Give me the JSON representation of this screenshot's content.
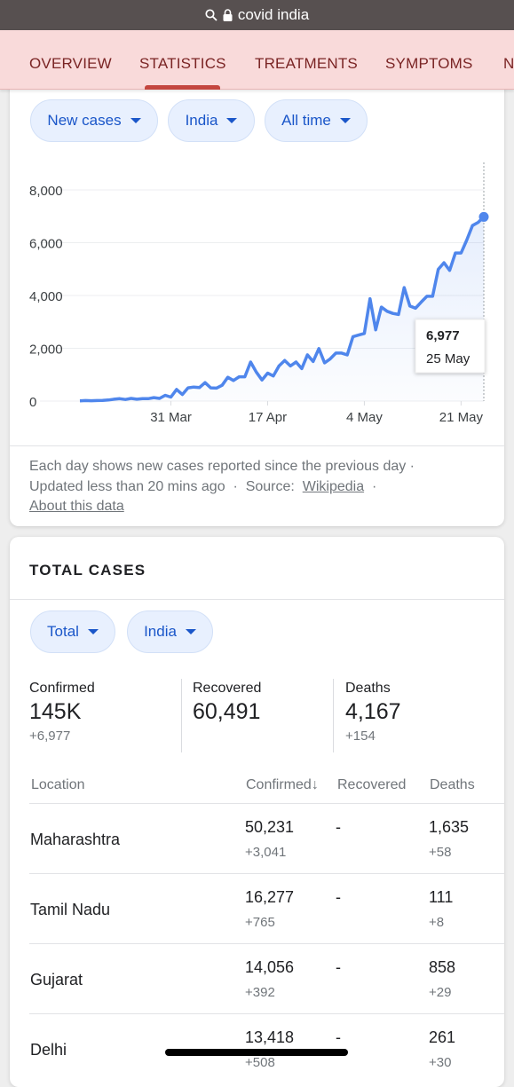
{
  "browser": {
    "url_text": "covid india",
    "icons": [
      "search-icon",
      "lock-icon"
    ]
  },
  "tabs": [
    {
      "label": "OVERVIEW"
    },
    {
      "label": "STATISTICS",
      "active": true
    },
    {
      "label": "TREATMENTS"
    },
    {
      "label": "SYMPTOMS"
    },
    {
      "label": "N"
    }
  ],
  "chart_card": {
    "filters": [
      "New cases",
      "India",
      "All time"
    ],
    "footer": {
      "line1": "Each day shows new cases reported since the previous day ·",
      "updated": "Updated less than 20 mins ago",
      "sep": "·",
      "source_label": "Source:",
      "source_link": "Wikipedia",
      "sep2": "·",
      "about": "About this data"
    }
  },
  "chart_data": {
    "type": "area",
    "x_start": "2020-03-15",
    "x_end": "2020-05-25",
    "x_interval": "day",
    "xticks": [
      "31 Mar",
      "17 Apr",
      "4 May",
      "21 May"
    ],
    "xtick_dates": [
      "2020-03-31",
      "2020-04-17",
      "2020-05-04",
      "2020-05-21"
    ],
    "yticks": [
      "0",
      "2,000",
      "4,000",
      "6,000",
      "8,000"
    ],
    "ytick_values": [
      0,
      2000,
      4000,
      6000,
      8000
    ],
    "ylim": [
      0,
      8000
    ],
    "grid": true,
    "color": "#4f86ec",
    "values": [
      10,
      20,
      15,
      20,
      25,
      40,
      70,
      90,
      60,
      100,
      70,
      90,
      90,
      130,
      100,
      220,
      150,
      440,
      250,
      500,
      530,
      510,
      700,
      500,
      490,
      600,
      900,
      780,
      920,
      920,
      1480,
      1100,
      800,
      1060,
      950,
      1330,
      1540,
      1330,
      1480,
      1230,
      1750,
      1500,
      1990,
      1450,
      1600,
      1820,
      1820,
      1750,
      2440,
      2500,
      2560,
      3880,
      2700,
      3560,
      3400,
      3320,
      3280,
      4300,
      3600,
      3520,
      3750,
      3970,
      3970,
      4990,
      5240,
      4950,
      5610,
      5610,
      6100,
      6650,
      6770,
      6977
    ],
    "tooltip": {
      "value": "6,977",
      "date": "25 May"
    }
  },
  "total_card": {
    "title": "TOTAL CASES",
    "filters": [
      "Total",
      "India"
    ],
    "stats": [
      {
        "label": "Confirmed",
        "value": "145K",
        "delta": "+6,977"
      },
      {
        "label": "Recovered",
        "value": "60,491",
        "delta": ""
      },
      {
        "label": "Deaths",
        "value": "4,167",
        "delta": "+154"
      }
    ],
    "table": {
      "headers": [
        "Location",
        "Confirmed",
        "Recovered",
        "Deaths"
      ],
      "sort_icon": "arrow-down-icon",
      "rows": [
        {
          "location": "Maharashtra",
          "confirmed": "50,231",
          "confirmed_delta": "+3,041",
          "recovered": "-",
          "deaths": "1,635",
          "deaths_delta": "+58"
        },
        {
          "location": "Tamil Nadu",
          "confirmed": "16,277",
          "confirmed_delta": "+765",
          "recovered": "-",
          "deaths": "111",
          "deaths_delta": "+8"
        },
        {
          "location": "Gujarat",
          "confirmed": "14,056",
          "confirmed_delta": "+392",
          "recovered": "-",
          "deaths": "858",
          "deaths_delta": "+29"
        },
        {
          "location": "Delhi",
          "confirmed": "13,418",
          "confirmed_delta": "+508",
          "recovered": "-",
          "deaths": "261",
          "deaths_delta": "+30"
        }
      ]
    }
  }
}
